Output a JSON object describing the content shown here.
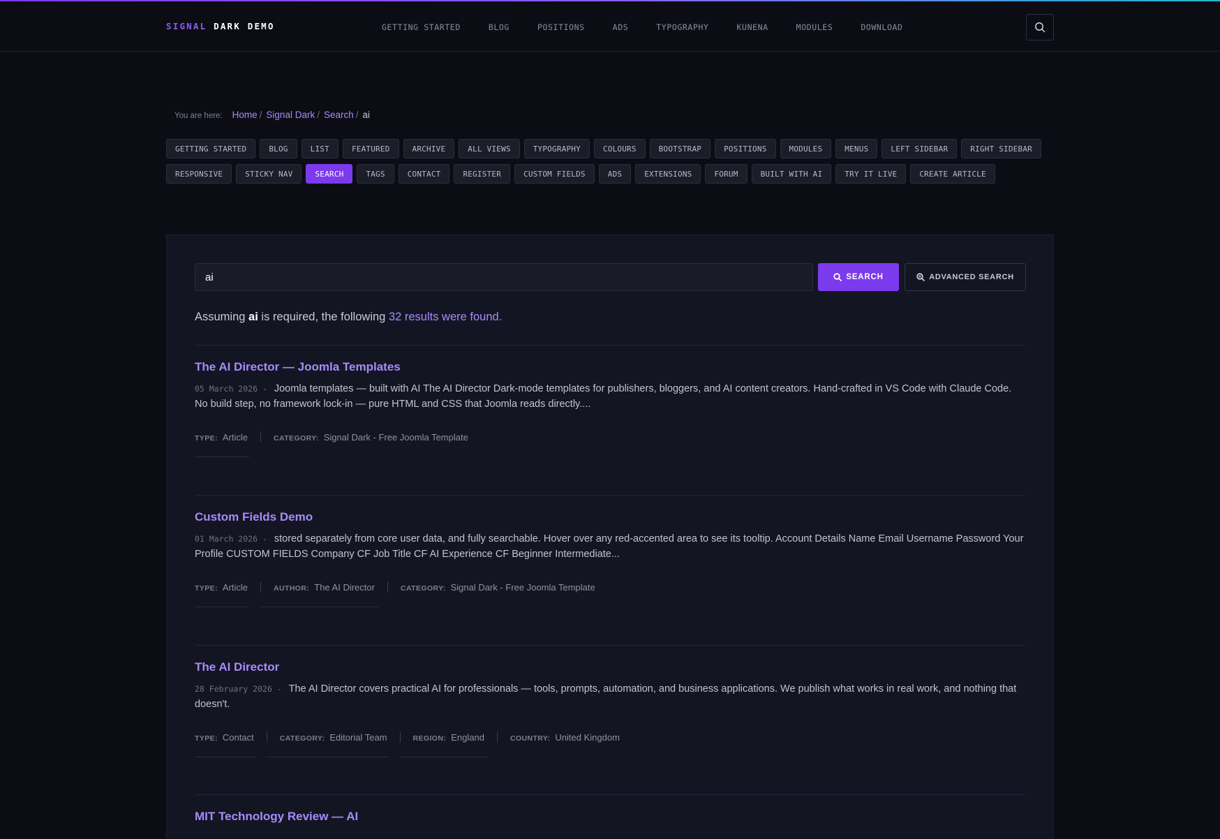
{
  "header": {
    "brand_part1": "SIGNAL",
    "brand_part2": "DARK DEMO",
    "nav": [
      "GETTING STARTED",
      "BLOG",
      "POSITIONS",
      "ADS",
      "TYPOGRAPHY",
      "KUNENA",
      "MODULES",
      "DOWNLOAD"
    ],
    "search_icon": "search-icon"
  },
  "breadcrumb": {
    "label": "You are here:",
    "items": [
      "Home",
      "Signal Dark",
      "Search"
    ],
    "separator": "/",
    "current": "ai"
  },
  "tags": {
    "items": [
      "GETTING STARTED",
      "BLOG",
      "LIST",
      "FEATURED",
      "ARCHIVE",
      "ALL VIEWS",
      "TYPOGRAPHY",
      "COLOURS",
      "BOOTSTRAP",
      "POSITIONS",
      "MODULES",
      "MENUS",
      "LEFT SIDEBAR",
      "RIGHT SIDEBAR",
      "RESPONSIVE",
      "STICKY NAV",
      "SEARCH",
      "TAGS",
      "CONTACT",
      "REGISTER",
      "CUSTOM FIELDS",
      "ADS",
      "EXTENSIONS",
      "FORUM",
      "BUILT WITH AI",
      "TRY IT LIVE",
      "CREATE ARTICLE"
    ],
    "active": "SEARCH"
  },
  "search": {
    "value": "ai",
    "search_label": "SEARCH",
    "advanced_label": "ADVANCED SEARCH"
  },
  "summary": {
    "prefix": "Assuming",
    "term": "ai",
    "middle": "is required, the following",
    "count_text": "32 results were found."
  },
  "results": [
    {
      "title": "The AI Director — Joomla Templates",
      "date": "05 March 2026 -",
      "description": "Joomla templates — built with AI The AI Director Dark-mode templates for publishers, bloggers, and AI content creators. Hand-crafted in VS Code with Claude Code. No build step, no framework lock-in — pure HTML and CSS that Joomla reads directly....",
      "meta": [
        {
          "key": "TYPE:",
          "value": "Article"
        },
        {
          "key": "CATEGORY:",
          "value": "Signal Dark - Free Joomla Template"
        }
      ]
    },
    {
      "title": "Custom Fields Demo",
      "date": "01 March 2026 -",
      "description": "stored separately from core user data, and fully searchable. Hover over any red-accented area to see its tooltip. Account Details Name Email Username Password Your Profile CUSTOM FIELDS Company CF Job Title CF AI Experience CF Beginner Intermediate...",
      "meta": [
        {
          "key": "TYPE:",
          "value": "Article"
        },
        {
          "key": "AUTHOR:",
          "value": "The AI Director"
        },
        {
          "key": "CATEGORY:",
          "value": "Signal Dark - Free Joomla Template"
        }
      ]
    },
    {
      "title": "The AI Director",
      "date": "28 February 2026 -",
      "description": "The AI Director covers practical AI for professionals — tools, prompts, automation, and business applications. We publish what works in real work, and nothing that doesn't.",
      "meta": [
        {
          "key": "TYPE:",
          "value": "Contact"
        },
        {
          "key": "CATEGORY:",
          "value": "Editorial Team"
        },
        {
          "key": "REGION:",
          "value": "England"
        },
        {
          "key": "COUNTRY:",
          "value": "United Kingdom"
        }
      ]
    },
    {
      "title": "MIT Technology Review — AI"
    }
  ],
  "colors": {
    "accent": "#7c3aed",
    "link": "#a78bfa",
    "background": "#0c0d14",
    "panel": "#141522"
  }
}
